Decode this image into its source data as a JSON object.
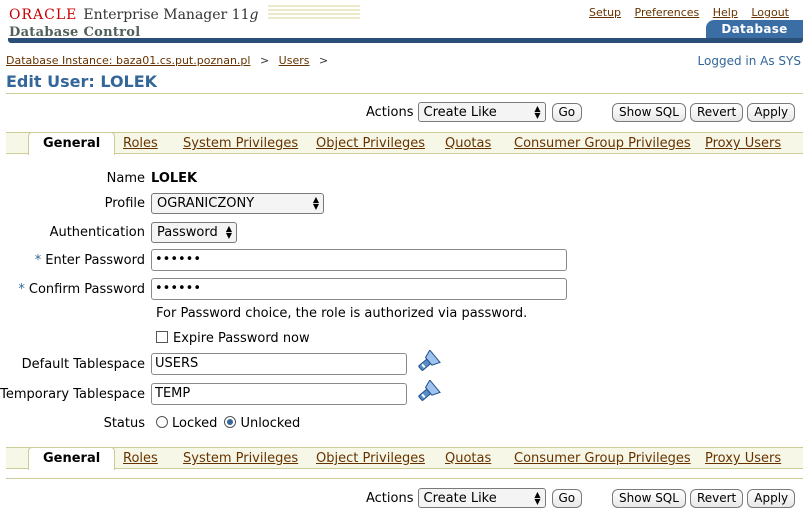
{
  "header": {
    "oracle": "ORACLE",
    "product": "Enterprise Manager 11",
    "product_ver": "g",
    "subtitle": "Database Control",
    "links": [
      "Setup",
      "Preferences",
      "Help",
      "Logout"
    ],
    "tab": "Database"
  },
  "breadcrumb": {
    "instance": "Database Instance: baza01.cs.put.poznan.pl",
    "sep": ">",
    "users": "Users"
  },
  "logged_in": "Logged in As SYS",
  "page_title": "Edit User: LOLEK",
  "actions": {
    "label": "Actions",
    "selected": "Create Like",
    "go": "Go",
    "show_sql": "Show SQL",
    "revert": "Revert",
    "apply": "Apply"
  },
  "tabs": [
    "General",
    "Roles",
    "System Privileges",
    "Object Privileges",
    "Quotas",
    "Consumer Group Privileges",
    "Proxy Users"
  ],
  "form": {
    "name_label": "Name",
    "name_value": "LOLEK",
    "profile_label": "Profile",
    "profile_value": "OGRANICZONY",
    "auth_label": "Authentication",
    "auth_value": "Password",
    "req_mark": "*",
    "enter_pw_label": "Enter Password",
    "enter_pw_value": "••••••",
    "confirm_pw_label": "Confirm Password",
    "confirm_pw_value": "••••••",
    "pw_hint": "For Password choice, the role is authorized via password.",
    "expire_label": "Expire Password now",
    "default_ts_label": "Default Tablespace",
    "default_ts_value": "USERS",
    "temp_ts_label": "Temporary Tablespace",
    "temp_ts_value": "TEMP",
    "status_label": "Status",
    "locked": "Locked",
    "unlocked": "Unlocked"
  },
  "icons": {
    "search": "flashlight-icon",
    "select_arrows": "updown-arrows-icon"
  }
}
